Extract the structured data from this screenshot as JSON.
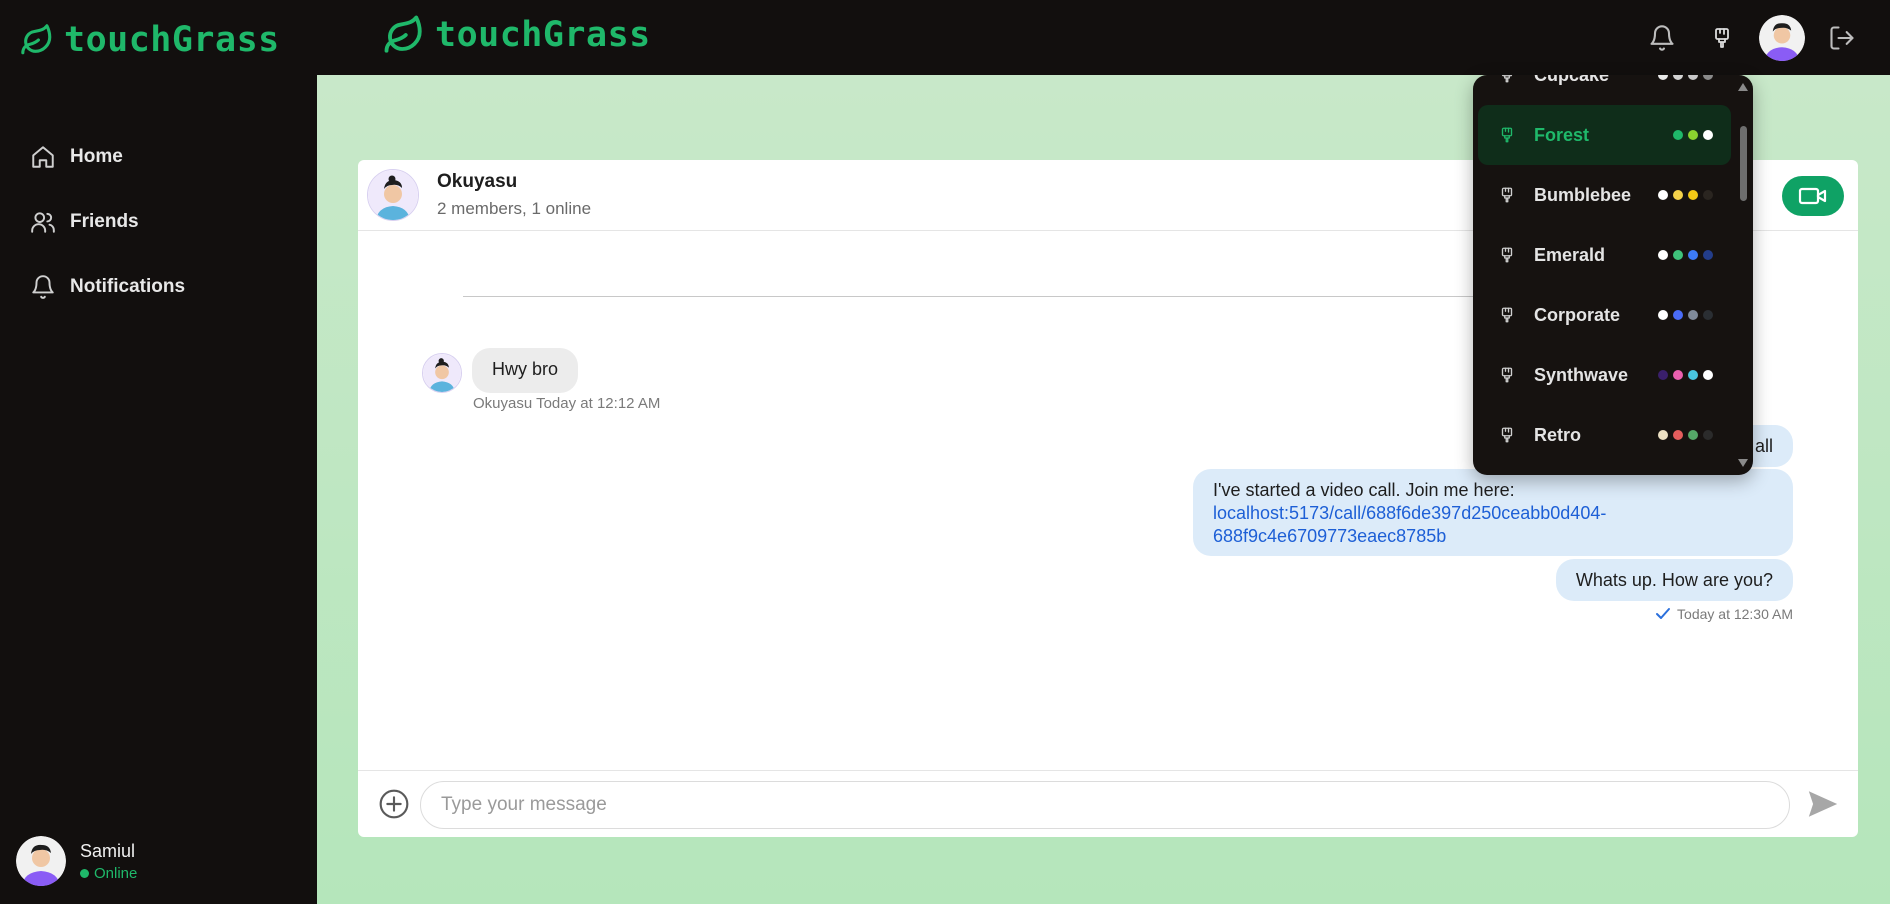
{
  "app": {
    "brand": "touchGrass",
    "brand_color": "#1fb86a"
  },
  "sidebar": {
    "items": [
      {
        "label": "Home",
        "icon": "home-icon"
      },
      {
        "label": "Friends",
        "icon": "users-icon"
      },
      {
        "label": "Notifications",
        "icon": "bell-icon"
      }
    ],
    "profile": {
      "name": "Samiul",
      "status": "Online"
    }
  },
  "topbar": {
    "icons": [
      "bell-icon",
      "paint-brush-icon",
      "avatar",
      "logout-icon"
    ]
  },
  "chat": {
    "name": "Okuyasu",
    "members": "2 members, 1 online",
    "messages_in": [
      {
        "text": "Hwy bro",
        "meta": "Okuyasu Today at 12:12 AM"
      }
    ],
    "messages_out": [
      {
        "text": "all"
      },
      {
        "text": "I've started a video call. Join me here:",
        "link_line1": "localhost:5173/call/688f6de397d250ceabb0d404-",
        "link_line2": "688f9c4e6709773eaec8785b"
      },
      {
        "text": "Whats up. How are you?"
      }
    ],
    "sent_meta": "Today at 12:30 AM",
    "composer_placeholder": "Type your message"
  },
  "themes": {
    "items": [
      {
        "name": "Cupcake",
        "active": false,
        "colors": [
          "#e8e8e8",
          "#d3d3d3",
          "#c8c8c8",
          "#8a8a8a"
        ]
      },
      {
        "name": "Forest",
        "active": true,
        "colors": [
          "#1fb86a",
          "#8ad32f",
          "#ffffff"
        ]
      },
      {
        "name": "Bumblebee",
        "active": false,
        "colors": [
          "#ffffff",
          "#f4d24a",
          "#f2c916",
          "#2a2520"
        ]
      },
      {
        "name": "Emerald",
        "active": false,
        "colors": [
          "#ffffff",
          "#3fc27a",
          "#3d7bf5",
          "#233d8a"
        ]
      },
      {
        "name": "Corporate",
        "active": false,
        "colors": [
          "#ffffff",
          "#4a6cf7",
          "#7f8a9a",
          "#2a2e33"
        ]
      },
      {
        "name": "Synthwave",
        "active": false,
        "colors": [
          "#3a1f6b",
          "#ea5fae",
          "#4ac6e0",
          "#ffffff"
        ]
      },
      {
        "name": "Retro",
        "active": false,
        "colors": [
          "#ece0c3",
          "#e45d5d",
          "#55a868",
          "#2b2b2b"
        ]
      }
    ]
  }
}
